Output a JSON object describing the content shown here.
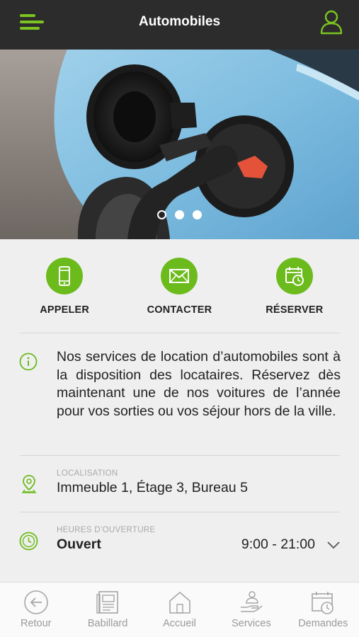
{
  "header": {
    "title": "Automobiles"
  },
  "carousel": {
    "slides": 3,
    "active_index": 0
  },
  "actions": [
    {
      "label": "APPELER",
      "icon": "phone-icon"
    },
    {
      "label": "CONTACTER",
      "icon": "envelope-icon"
    },
    {
      "label": "RÉSERVER",
      "icon": "calendar-clock-icon"
    }
  ],
  "info": {
    "text": "Nos services de location d’automobiles sont à la disposition des locataires. Réservez dès maintenant une de nos voitures de l’année pour vos sorties ou vos séjour hors de la ville."
  },
  "location": {
    "label": "LOCALISATION",
    "value": "Immeuble 1, Étage 3, Bureau 5"
  },
  "hours": {
    "label": "HEURES D’OUVERTURE",
    "status": "Ouvert",
    "range": "9:00 - 21:00"
  },
  "bottom_nav": [
    {
      "label": "Retour",
      "icon": "back-arrow-icon"
    },
    {
      "label": "Babillard",
      "icon": "bulletin-board-icon"
    },
    {
      "label": "Accueil",
      "icon": "home-icon"
    },
    {
      "label": "Services",
      "icon": "concierge-icon"
    },
    {
      "label": "Demandes",
      "icon": "calendar-request-icon"
    }
  ],
  "colors": {
    "accent": "#6cbb1c",
    "topbar": "#2c2c2c",
    "background": "#efefef",
    "muted": "#9a9a9a"
  }
}
